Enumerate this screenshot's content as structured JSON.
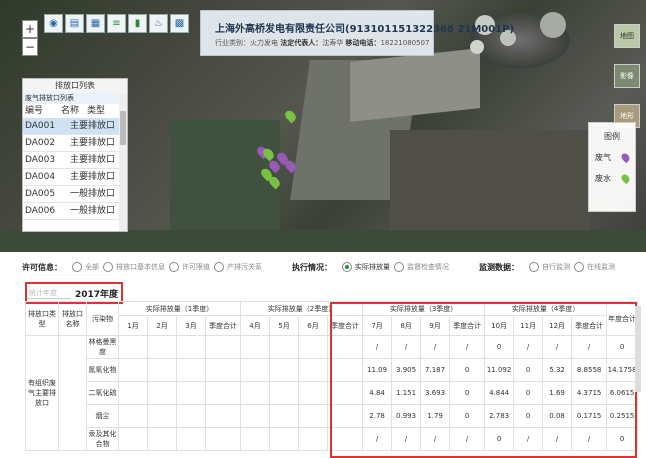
{
  "company": {
    "title": "上海外高桥发电有限责任公司(913101151322366 21M001P)",
    "industry_label": "行业类别：",
    "industry": "火力发电",
    "legal_label": "法定代表人：",
    "legal": "沈寿华",
    "phone_label": "移动电话：",
    "phone": "18221080507"
  },
  "map": {
    "zoom_in": "+",
    "zoom_out": "−",
    "layer_labels": [
      "地图",
      "影像",
      "地形"
    ],
    "legend": {
      "title": "图例",
      "items": [
        {
          "label": "废气",
          "color": "#9b59b6"
        },
        {
          "label": "废水",
          "color": "#7ac143"
        }
      ]
    }
  },
  "outlet_panel": {
    "title": "排放口列表",
    "subtitle": "废气排放口列表",
    "columns": [
      "编号",
      "名称",
      "类型"
    ],
    "rows": [
      {
        "code": "DA001",
        "type": "主要排放口"
      },
      {
        "code": "DA002",
        "type": "主要排放口"
      },
      {
        "code": "DA003",
        "type": "主要排放口"
      },
      {
        "code": "DA004",
        "type": "主要排放口"
      },
      {
        "code": "DA005",
        "type": "一般排放口"
      },
      {
        "code": "DA006",
        "type": "一般排放口"
      }
    ]
  },
  "filters": {
    "permit_label": "许可信息：",
    "permit_options": [
      "全部",
      "排放口基本信息",
      "许可限值",
      "产排污关系"
    ],
    "exec_label": "执行情况：",
    "exec_options": [
      "实际排放量",
      "监督检查情况"
    ],
    "monitor_label": "监测数据：",
    "monitor_options": [
      "自行监测",
      "在线监测"
    ]
  },
  "year": {
    "placeholder": "统计年度",
    "value": "2017年度"
  },
  "table": {
    "head1": [
      "排放口类型",
      "排放口名称",
      "污染物",
      "实际排放量（1季度）",
      "实际排放量（2季度）",
      "实际排放量（3季度）",
      "实际排放量（4季度）",
      "年度合计"
    ],
    "head2": [
      "1月",
      "2月",
      "3月",
      "季度合计",
      "4月",
      "5月",
      "6月",
      "季度合计",
      "7月",
      "8月",
      "9月",
      "季度合计",
      "10月",
      "11月",
      "12月",
      "季度合计"
    ],
    "group_label": "有组织废气主要排放口",
    "rows": [
      {
        "pollutant": "林格曼黑度",
        "q3": [
          "/",
          "/",
          "/",
          "/"
        ],
        "q4": [
          "0",
          "/",
          "/",
          "/"
        ],
        "q4sum": "0"
      },
      {
        "pollutant": "氮氧化物",
        "q3": [
          "11.09",
          "3.905",
          "7.187",
          "0"
        ],
        "q4": [
          "11.092",
          "0",
          "5.32",
          "8.8558"
        ],
        "q4sum": "14.1758"
      },
      {
        "pollutant": "二氧化硫",
        "q3": [
          "4.84",
          "1.151",
          "3.693",
          "0"
        ],
        "q4": [
          "4.844",
          "0",
          "1.69",
          "4.3715"
        ],
        "q4sum": "6.0615"
      },
      {
        "pollutant": "烟尘",
        "q3": [
          "2.78",
          "0.993",
          "1.79",
          "0"
        ],
        "q4": [
          "2.783",
          "0",
          "0.08",
          "0.1715"
        ],
        "q4sum": "0.2515"
      },
      {
        "pollutant": "汞及其化合物",
        "q3": [
          "/",
          "/",
          "/",
          "/"
        ],
        "q4": [
          "0",
          "/",
          "/",
          "/"
        ],
        "q4sum": "0"
      }
    ]
  }
}
